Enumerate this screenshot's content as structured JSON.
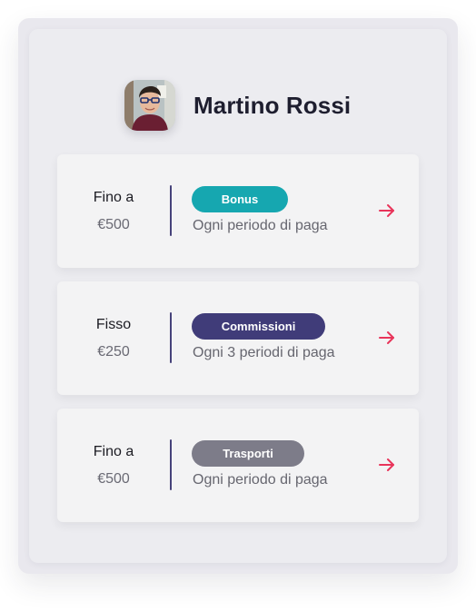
{
  "profile": {
    "name": "Martino Rossi"
  },
  "colors": {
    "arrow": "#e8345a",
    "divider": "#46427a"
  },
  "cards": [
    {
      "title": "Fino a",
      "amount": "€500",
      "badge": "Bonus",
      "badge_color": "#16a7b0",
      "period": "Ogni periodo di paga"
    },
    {
      "title": "Fisso",
      "amount": "€250",
      "badge": "Commissioni",
      "badge_color": "#403c79",
      "period": "Ogni 3 periodi di paga"
    },
    {
      "title": "Fino a",
      "amount": "€500",
      "badge": "Trasporti",
      "badge_color": "#7d7c89",
      "period": "Ogni periodo di paga"
    }
  ]
}
